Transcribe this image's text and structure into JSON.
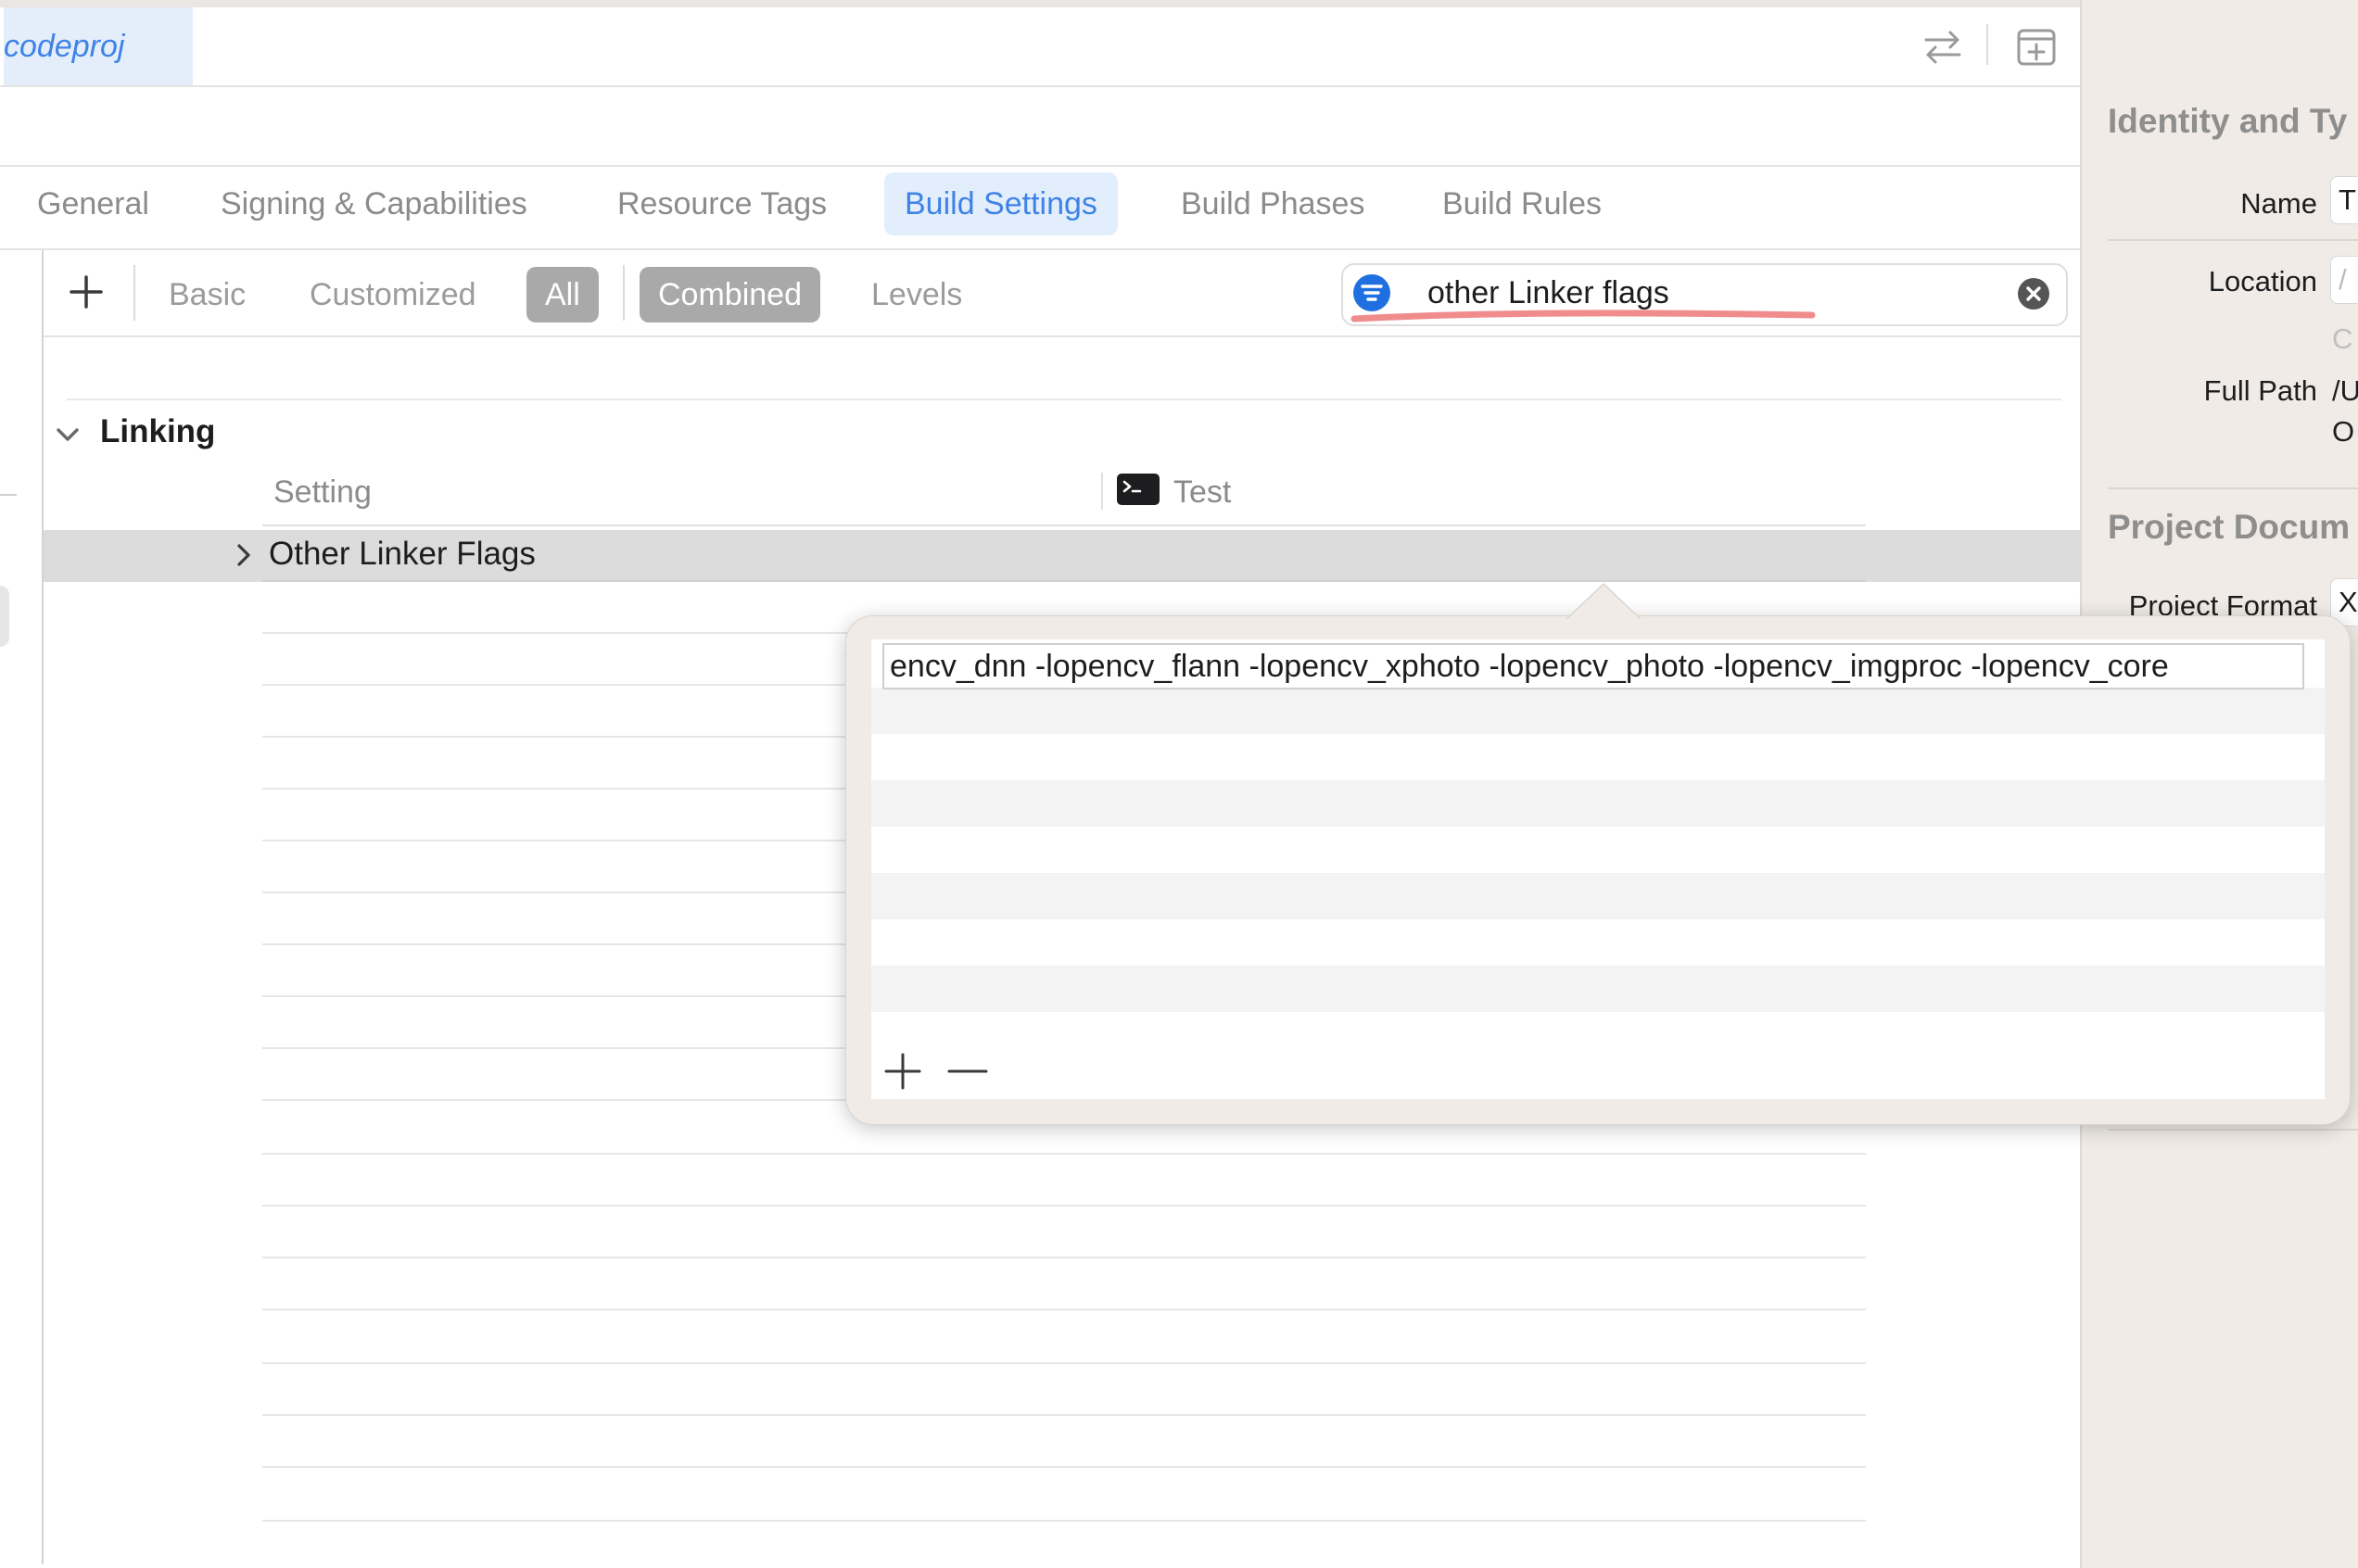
{
  "file_tab": {
    "label": "codeproj"
  },
  "tabs": [
    {
      "label": "General"
    },
    {
      "label": "Signing & Capabilities"
    },
    {
      "label": "Resource Tags"
    },
    {
      "label": "Build Settings"
    },
    {
      "label": "Build Phases"
    },
    {
      "label": "Build Rules"
    }
  ],
  "active_tab": "Build Settings",
  "filter": {
    "basic": "Basic",
    "customized": "Customized",
    "all": "All",
    "combined": "Combined",
    "levels": "Levels"
  },
  "search": {
    "value": "other Linker flags"
  },
  "section": {
    "title": "Linking"
  },
  "columns": {
    "setting": "Setting",
    "target": "Test"
  },
  "row": {
    "label": "Other Linker Flags"
  },
  "popover": {
    "value": "encv_dnn -lopencv_flann -lopencv_xphoto -lopencv_photo -lopencv_imgproc -lopencv_core"
  },
  "inspector": {
    "identity_title": "Identity and Ty",
    "name_label": "Name",
    "name_value": "T",
    "location_label": "Location",
    "location_value": "/",
    "location_sub": "C",
    "full_path_label": "Full Path",
    "full_path_value": "/U",
    "full_path_value2": "O",
    "project_doc_title": "Project Docum",
    "project_format_label": "Project Format",
    "project_format_value": "X"
  },
  "colors": {
    "accent": "#3f83e6",
    "selected_row": "#dcdcdc",
    "inspector_bg": "#f0ebe6",
    "annotation_underline": "#f08c8c"
  }
}
